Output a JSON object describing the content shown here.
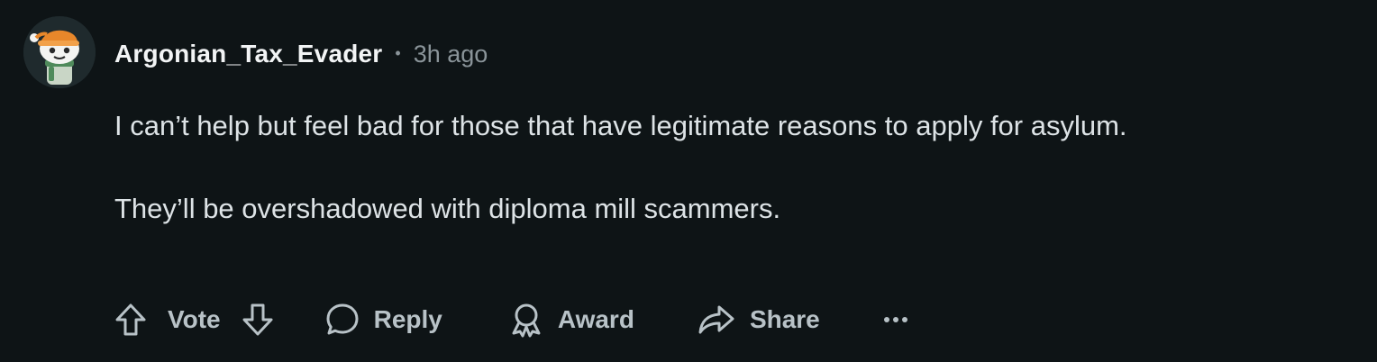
{
  "comment": {
    "username": "Argonian_Tax_Evader",
    "separator": "•",
    "timestamp": "3h ago",
    "paragraphs": [
      "I can’t help but feel bad for those that have legitimate reasons to apply for asylum.",
      "They’ll be overshadowed with diploma mill scammers."
    ]
  },
  "actions": {
    "upvote_icon": "arrow-up-outline-icon",
    "vote_label": "Vote",
    "downvote_icon": "arrow-down-outline-icon",
    "reply_icon": "speech-bubble-icon",
    "reply_label": "Reply",
    "award_icon": "ribbon-award-icon",
    "award_label": "Award",
    "share_icon": "share-arrow-icon",
    "share_label": "Share",
    "more_icon": "ellipsis-icon"
  },
  "colors": {
    "background": "#0e1416",
    "username": "#f2f4f5",
    "meta": "#8a9499",
    "body_text": "#dde3e6",
    "action_text": "#b8c2c7"
  }
}
